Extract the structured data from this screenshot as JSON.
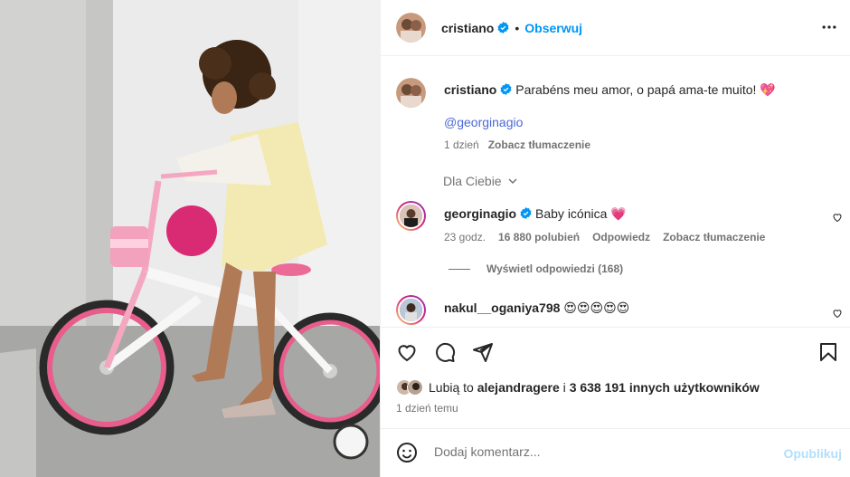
{
  "post": {
    "author": "cristiano",
    "dot": "•",
    "follow_label": "Obserwuj",
    "more_label": "Więcej opcji"
  },
  "caption": {
    "username": "cristiano",
    "text": "Parabéns meu amor, o papá ama-te muito! 💖",
    "mention": "@georginagio",
    "time": "1 dzień",
    "translate": "Zobacz tłumaczenie"
  },
  "for_you": {
    "label": "Dla Ciebie"
  },
  "comments": [
    {
      "username": "georginagio",
      "text": "Baby icónica 💗",
      "time": "23 godz.",
      "likes": "16 880 polubień",
      "reply": "Odpowiedz",
      "translate": "Zobacz tłumaczenie",
      "replies_label": "Wyświetl odpowiedzi (168)"
    },
    {
      "username": "nakul__oganiya798",
      "text": "😍😍😍😍😍"
    }
  ],
  "likes_line": {
    "prefix": "Lubią to",
    "user": "alejandragere",
    "middle": "i",
    "count_text": "3 638 191 innych użytkowników"
  },
  "posted_time": "1 dzień temu",
  "add_comment": {
    "placeholder": "Dodaj komentarz...",
    "publish_label": "Opublikuj"
  },
  "colors": {
    "accent": "#0095f6",
    "mention": "#4c68d7",
    "muted": "#737373",
    "publish_disabled": "#b2dffc",
    "story_ring": "#d6249f"
  },
  "icons": [
    "verified-badge-icon",
    "more-dots-icon",
    "chevron-down-icon",
    "heart-icon",
    "comment-icon",
    "share-icon",
    "bookmark-icon",
    "emoji-icon"
  ]
}
